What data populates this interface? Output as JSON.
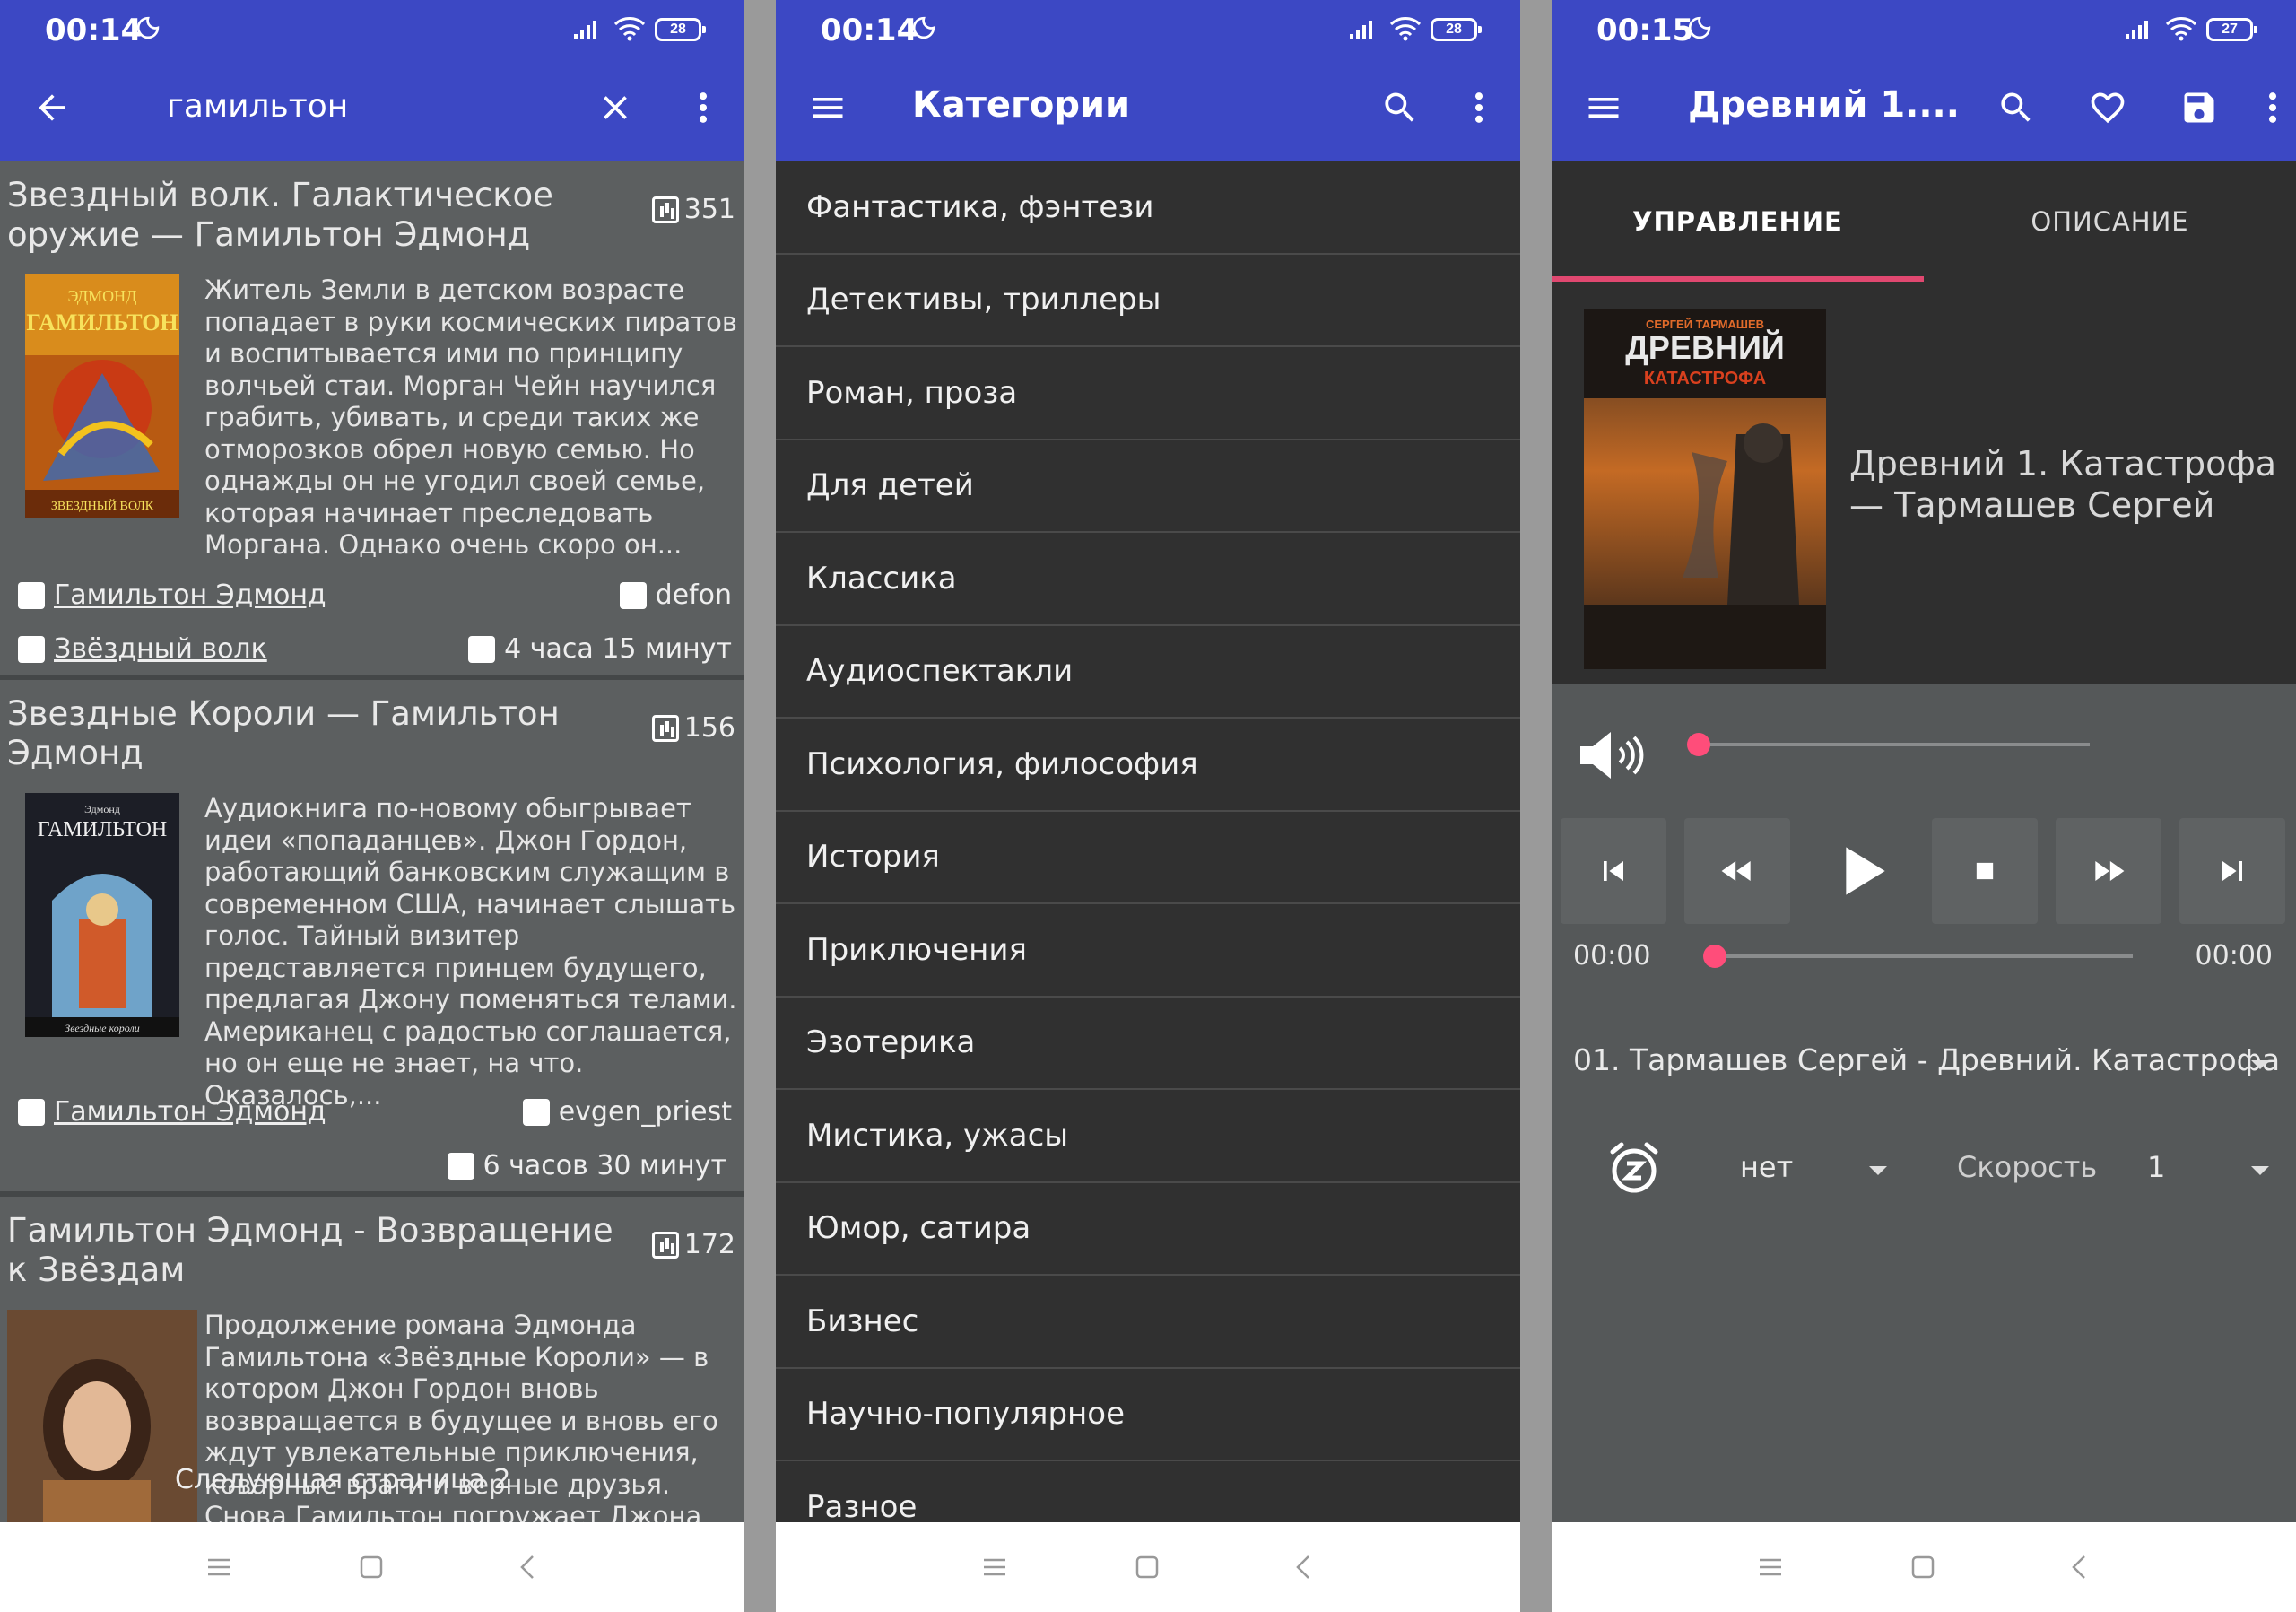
{
  "status_bars": [
    {
      "time": "00:14",
      "battery": "28"
    },
    {
      "time": "00:14",
      "battery": "28"
    },
    {
      "time": "00:15",
      "battery": "27"
    }
  ],
  "panel1": {
    "search_query": "гамильтон",
    "next_page": "Следующая страница 2",
    "cards": [
      {
        "title": "Звездный волк. Галактическое оружие — Гамильтон Эдмонд",
        "views": "351",
        "description": "Житель Земли в детском возрасте попадает в руки космических пиратов и воспитывается ими по принципу волчьей стаи. Морган Чейн научился грабить, убивать, и среди таких же отморозков обрел новую семью. Но однажды он не угодил своей семье, которая начинает преследовать Моргана. Однако очень скоро он...",
        "author": "Гамильтон Эдмонд",
        "reader": "defon",
        "series": "Звёздный волк",
        "duration": "4 часа 15 минут"
      },
      {
        "title": "Звездные Короли — Гамильтон Эдмонд",
        "views": "156",
        "description": "Аудиокнига по-новому обыгрывает идеи «попаданцев». Джон Гордон, работающий банковским служащим в современном США, начинает слышать голос. Тайный визитер представляется принцем будущего, предлагая Джону поменяться телами. Американец с радостью соглашается, но он еще не знает, на что. Оказалось,...",
        "author": "Гамильтон Эдмонд",
        "reader": "evgen_priest",
        "duration": "6 часов 30 минут"
      },
      {
        "title": "Гамильтон Эдмонд - Возвращение к Звёздам",
        "views": "172",
        "description": "Продолжение романа Эдмонда Гамильтона «Звёздные Короли» — в котором Джон Гордон вновь возвращается в будущее и вновь его ждут увлекательные приключения, коварные враги и верные друзья. Снова Гамильтон погружает Джона Гордона,"
      }
    ]
  },
  "panel2": {
    "title": "Категории",
    "categories": [
      "Фантастика, фэнтези",
      "Детективы, триллеры",
      "Роман, проза",
      "Для детей",
      "Классика",
      "Аудиоспектакли",
      "Психология, философия",
      "История",
      "Приключения",
      "Эзотерика",
      "Мистика, ужасы",
      "Юмор, сатира",
      "Бизнес",
      "Научно-популярное",
      "Разное"
    ]
  },
  "panel3": {
    "title": "Древний 1....",
    "tab_control": "УПРАВЛЕНИЕ",
    "tab_description": "ОПИСАНИЕ",
    "book_title": "Древний 1. Катастрофа — Тармашев Сергей",
    "cover_author": "СЕРГЕЙ ТАРМАШЕВ",
    "cover_title": "ДРЕВНИЙ",
    "cover_subtitle": "КАТАСТРОФА",
    "time_current": "00:00",
    "time_total": "00:00",
    "volume_level": 0,
    "progress": 0,
    "track": "01. Тармашев Сергей - Древний. Катастрофа",
    "sleep_timer": "нет",
    "speed_label": "Скорость",
    "speed_value": "1"
  },
  "colors": {
    "appbar": "#3c48c4",
    "accent": "#ff4d7a",
    "tab_indicator": "#e04870"
  },
  "icons": [
    "back-arrow-icon",
    "close-icon",
    "more-vert-icon",
    "menu-icon",
    "search-icon",
    "heart-icon",
    "save-icon",
    "volume-icon",
    "skip-previous-icon",
    "rewind-icon",
    "play-icon",
    "stop-icon",
    "fast-forward-icon",
    "skip-next-icon",
    "alarm-snooze-icon",
    "person-icon",
    "mic-icon",
    "list-icon",
    "timer-icon",
    "stats-icon"
  ]
}
